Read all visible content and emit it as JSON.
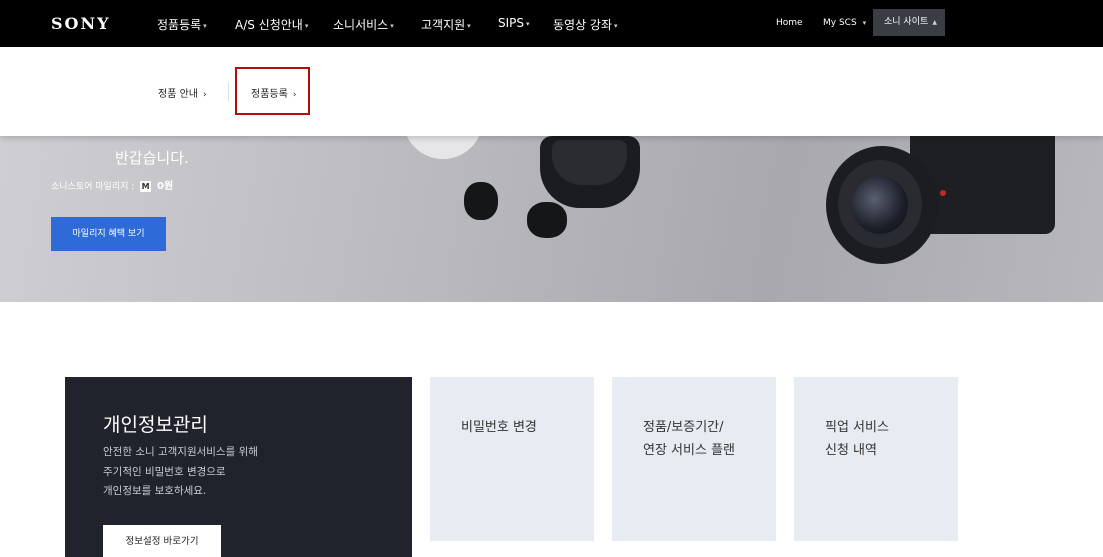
{
  "header": {
    "logo": "SONY",
    "menu": [
      {
        "label": "정품등록"
      },
      {
        "label": "A/S 신청안내"
      },
      {
        "label": "소니서비스"
      },
      {
        "label": "고객지원"
      },
      {
        "label": "SIPS"
      },
      {
        "label": "동영상 강좌"
      }
    ],
    "home_link": "Home",
    "myscs_link": "My SCS",
    "site_button": "소니 사이트"
  },
  "breadcrumb": {
    "items": [
      {
        "label": "정품 안내",
        "arrow": "›"
      },
      {
        "label": "정품등록",
        "arrow": "›"
      }
    ]
  },
  "hero": {
    "greeting": "반갑습니다.",
    "mileage_label": "소니스토어 마일리지 :",
    "mileage_badge": "M",
    "mileage_value": "0원",
    "benefit_button": "마일리지 혜택 보기"
  },
  "privacy_card": {
    "title": "개인정보관리",
    "description_lines": [
      "안전한 소니 고객지원서비스를 위해",
      "주기적인 비밀번호 변경으로",
      "개인정보를 보호하세요."
    ],
    "button": "정보설정 바로가기"
  },
  "service_cards": [
    {
      "label": "비밀번호 변경"
    },
    {
      "label": "정품/보증기간/\n연장 서비스 플랜"
    },
    {
      "label": "픽업 서비스\n신청 내역"
    }
  ],
  "colors": {
    "nav_bg": "#000000",
    "accent_blue": "#2e6bd8",
    "highlight_red": "#b00e0e",
    "dark_card": "#20232b",
    "light_card": "#e7ebf2"
  }
}
